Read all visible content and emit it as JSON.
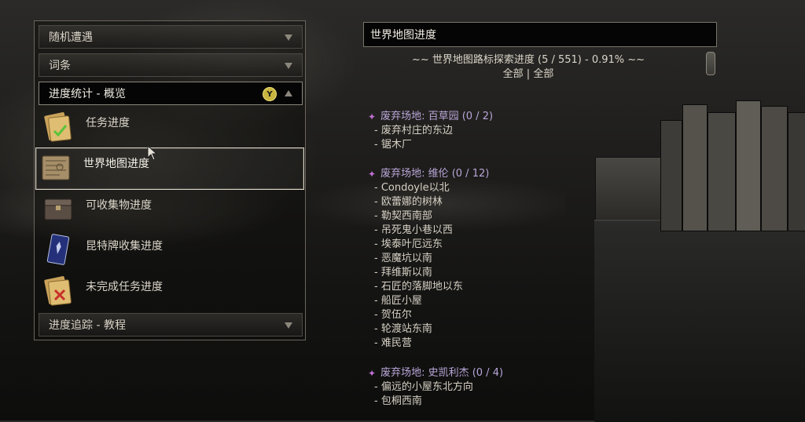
{
  "accordion": {
    "random_encounters": "随机遭遇",
    "glossary": "词条",
    "progress_stats": "进度统计 - 概览",
    "progress_tracking": "进度追踪 - 教程",
    "button_hint": "Y"
  },
  "submenu": [
    {
      "label": "任务进度",
      "icon": "quest-scroll-check-icon"
    },
    {
      "label": "世界地图进度",
      "icon": "map-scroll-icon"
    },
    {
      "label": "可收集物进度",
      "icon": "chest-icon"
    },
    {
      "label": "昆特牌收集进度",
      "icon": "gwent-card-icon"
    },
    {
      "label": "未完成任务进度",
      "icon": "quest-scroll-x-icon"
    }
  ],
  "detail": {
    "title": "世界地图进度",
    "summary_line": "~~ 世界地图路标探索进度 (5 / 551) - 0.91% ~~",
    "filter_line": "全部 | 全部",
    "regions": [
      {
        "name": "废弃场地: 百草园 (0 / 2)",
        "locations": [
          "- 废弃村庄的东边",
          "- 锯木厂"
        ]
      },
      {
        "name": "废弃场地: 维伦 (0 / 12)",
        "locations": [
          "- Condoyle以北",
          "- 欧蕾娜的树林",
          "- 勒契西南部",
          "- 吊死鬼小巷以西",
          "- 埃泰叶厄远东",
          "- 恶魔坑以南",
          "- 拜维斯以南",
          "- 石匠的落脚地以东",
          "- 船匠小屋",
          "- 贺伍尔",
          "- 轮渡站东南",
          "- 难民营"
        ]
      },
      {
        "name": "废弃场地: 史凯利杰 (0 / 4)",
        "locations": [
          "- 偏远的小屋东北方向",
          "- 包桐西南"
        ]
      }
    ]
  },
  "colors": {
    "region_title": "#b9a6d8",
    "region_marker": "#c06fd2",
    "button_y": "#c8b440"
  }
}
